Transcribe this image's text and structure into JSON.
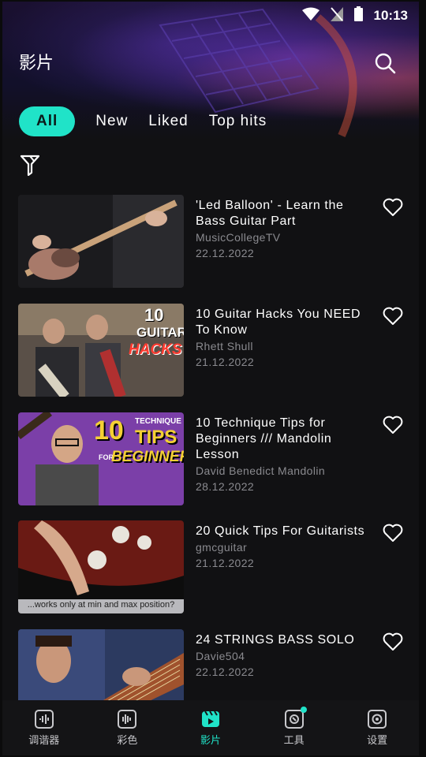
{
  "status_bar": {
    "time": "10:13",
    "icons": [
      "wifi-icon",
      "no-signal-icon",
      "battery-icon"
    ]
  },
  "header": {
    "title": "影片",
    "search_icon": "search-icon"
  },
  "tabs": [
    {
      "label": "All",
      "active": true
    },
    {
      "label": "New",
      "active": false
    },
    {
      "label": "Liked",
      "active": false
    },
    {
      "label": "Top hits",
      "active": false
    }
  ],
  "filter_icon": "filter-icon",
  "videos": [
    {
      "title": "'Led Balloon' - Learn the Bass Guitar Part",
      "channel": "MusicCollegeTV",
      "date": "22.12.2022",
      "liked": false
    },
    {
      "title": "10 Guitar Hacks You NEED To Know",
      "channel": "Rhett Shull",
      "date": "21.12.2022",
      "liked": false,
      "thumb_text": [
        "10",
        "GUITAR",
        "HACKS"
      ]
    },
    {
      "title": "10 Technique Tips for Beginners /// Mandolin Lesson",
      "channel": "David Benedict Mandolin",
      "date": "28.12.2022",
      "liked": false,
      "thumb_text": [
        "10",
        "TECHNIQUE",
        "TIPS",
        "FOR",
        "BEGINNERS"
      ]
    },
    {
      "title": "20 Quick Tips For Guitarists",
      "channel": "gmcguitar",
      "date": "21.12.2022",
      "liked": false,
      "thumb_text": [
        "...works only at min and max position?"
      ]
    },
    {
      "title": "24 STRINGS BASS SOLO",
      "channel": "Davie504",
      "date": "22.12.2022",
      "liked": false
    }
  ],
  "nav": [
    {
      "label": "调谐器",
      "icon": "tuner-icon",
      "active": false
    },
    {
      "label": "彩色",
      "icon": "audio-wave-icon",
      "active": false
    },
    {
      "label": "影片",
      "icon": "video-icon",
      "active": true
    },
    {
      "label": "工具",
      "icon": "tools-icon",
      "active": false,
      "badge": true
    },
    {
      "label": "设置",
      "icon": "settings-icon",
      "active": false
    }
  ],
  "colors": {
    "accent": "#20e3c8",
    "background": "#111113",
    "secondary_text": "#8a8a8f"
  }
}
